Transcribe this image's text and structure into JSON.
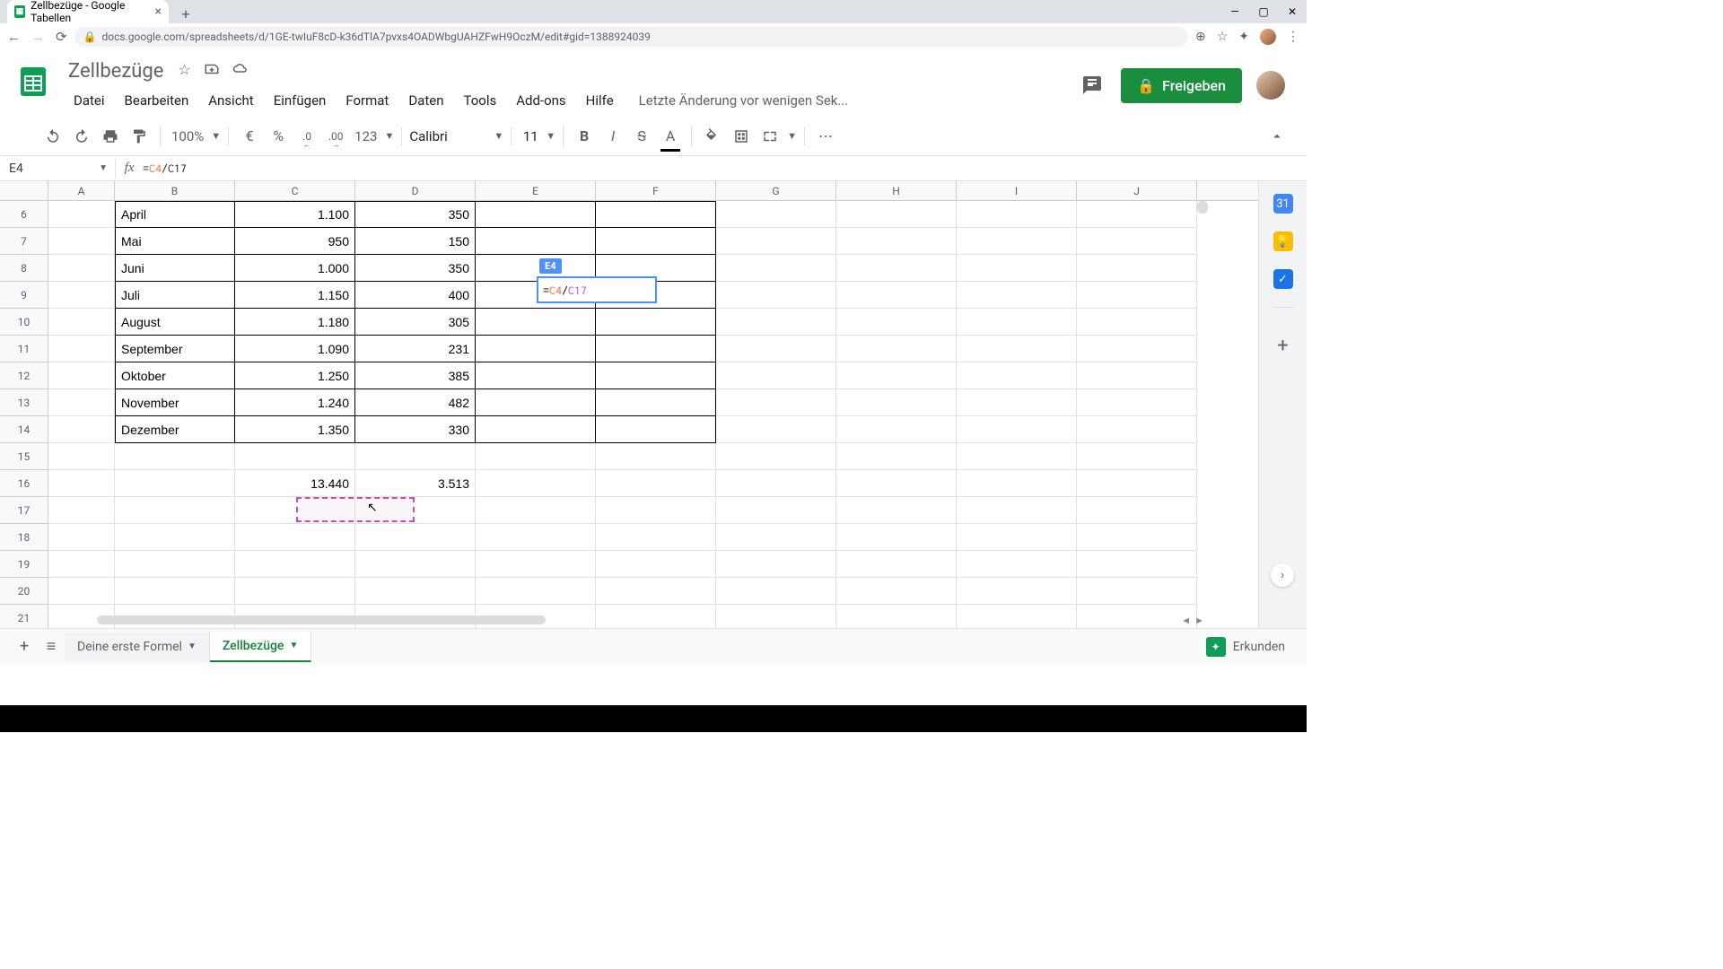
{
  "browser": {
    "tab_title": "Zellbezüge - Google Tabellen",
    "url": "docs.google.com/spreadsheets/d/1GE-twIuF8cD-k36dTlA7pvxs4OADWbgUAHZFwH9OczM/edit#gid=1388924039"
  },
  "doc": {
    "title": "Zellbezüge",
    "last_edit": "Letzte Änderung vor wenigen Sek...",
    "share_label": "Freigeben"
  },
  "menu": {
    "file": "Datei",
    "edit": "Bearbeiten",
    "view": "Ansicht",
    "insert": "Einfügen",
    "format": "Format",
    "data": "Daten",
    "tools": "Tools",
    "addons": "Add-ons",
    "help": "Hilfe"
  },
  "toolbar": {
    "zoom": "100%",
    "currency": "€",
    "percent": "%",
    "dec_dec": ".0",
    "inc_dec": ".00",
    "numfmt": "123",
    "font": "Calibri",
    "size": "11",
    "bold": "B",
    "italic": "I",
    "strike": "S",
    "textcolor": "A"
  },
  "namebox": "E4",
  "formula": {
    "prefix": "=",
    "ref1": "C4",
    "mid": "/C17"
  },
  "cols": [
    "A",
    "B",
    "C",
    "D",
    "E",
    "F",
    "G",
    "H",
    "I",
    "J"
  ],
  "rows": [
    "6",
    "7",
    "8",
    "9",
    "10",
    "11",
    "12",
    "13",
    "14",
    "15",
    "16",
    "17",
    "18",
    "19",
    "20",
    "21"
  ],
  "data_rows": [
    {
      "b": "April",
      "c": "1.100",
      "d": "350"
    },
    {
      "b": "Mai",
      "c": "950",
      "d": "150"
    },
    {
      "b": "Juni",
      "c": "1.000",
      "d": "350"
    },
    {
      "b": "Juli",
      "c": "1.150",
      "d": "400"
    },
    {
      "b": "August",
      "c": "1.180",
      "d": "305"
    },
    {
      "b": "September",
      "c": "1.090",
      "d": "231"
    },
    {
      "b": "Oktober",
      "c": "1.250",
      "d": "385"
    },
    {
      "b": "November",
      "c": "1.240",
      "d": "482"
    },
    {
      "b": "Dezember",
      "c": "1.350",
      "d": "330"
    }
  ],
  "totals": {
    "c": "13.440",
    "d": "3.513"
  },
  "editing": {
    "label": "E4",
    "prefix": "=",
    "ref1": "C4",
    "mid": "/",
    "ref2": "C17"
  },
  "sheets": {
    "tab1": "Deine erste Formel",
    "tab2": "Zellbezüge",
    "explore": "Erkunden"
  }
}
